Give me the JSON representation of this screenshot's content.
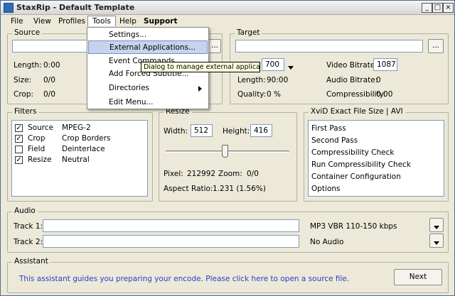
{
  "window": {
    "title": "StaxRip - Default Template",
    "buttons": [
      "_",
      "□",
      "×"
    ]
  },
  "menubar": {
    "items": [
      "File",
      "View",
      "Profiles",
      "Tools",
      "Help",
      "Support"
    ],
    "active": "Tools"
  },
  "tools_menu": {
    "items": [
      "Settings...",
      "External Applications...",
      "Event Commands",
      "Add Forced Subtitle...",
      "Directories",
      "Edit Menu..."
    ],
    "highlighted": "External Applications...",
    "tooltip": "Dialog to manage external applications"
  },
  "source": {
    "title": "Source",
    "path_value": "",
    "length_label": "Length:",
    "length_value": "0:00",
    "size_label": "Size:",
    "size_value": "0/0",
    "crop_label": "Crop:",
    "crop_value": "0/0"
  },
  "target": {
    "title": "Target",
    "path_value": "",
    "browse_label": "...",
    "size_value": "700",
    "video_bitrate_label": "Video Bitrate:",
    "video_bitrate_value": "1087",
    "length_label": "Length:",
    "length_value": "90:00",
    "audio_bitrate_label": "Audio Bitrate:",
    "audio_bitrate_value": "0",
    "quality_label": "Quality:",
    "quality_value": "0 %",
    "compressibility_label": "Compressibility:",
    "compressibility_value": "0.00"
  },
  "filters": {
    "title": "Filters",
    "items": [
      {
        "name": "Source",
        "value": "MPEG-2",
        "checked": true
      },
      {
        "name": "Crop",
        "value": "Crop Borders",
        "checked": true
      },
      {
        "name": "Field",
        "value": "Deinterlace",
        "checked": false
      },
      {
        "name": "Resize",
        "value": "Neutral",
        "checked": true
      }
    ]
  },
  "resize": {
    "title": "Resize",
    "width_label": "Width:",
    "width_value": "512",
    "height_label": "Height:",
    "height_value": "416",
    "slider_fraction": 0.48,
    "pixel_label": "Pixel:",
    "pixel_value": "212992",
    "zoom_label": "Zoom:",
    "zoom_value": "0/0",
    "aspect_label": "Aspect Ratio:",
    "aspect_value": "1.231 (1.56%)"
  },
  "encoder": {
    "title": "XviD Exact File Size | AVI",
    "items": [
      "First Pass",
      "Second Pass",
      "Compressibility Check",
      "Run Compressibility Check",
      "Container Configuration",
      "Options"
    ]
  },
  "audio": {
    "title": "Audio",
    "track1_label": "Track 1:",
    "track1_value": "",
    "track1_profile": "MP3 VBR 110-150 kbps",
    "track2_label": "Track 2:",
    "track2_value": "",
    "track2_profile": "No Audio"
  },
  "assistant": {
    "title": "Assistant",
    "message": "This assistant guides you preparing your encode. Please click here to open a source file.",
    "next_label": "Next"
  },
  "colors": {
    "menu_highlight": "#c7d3ec",
    "tooltip_bg": "#ffffe1",
    "link_text": "#2a3ec4",
    "window_bg": "#ece9d8"
  }
}
